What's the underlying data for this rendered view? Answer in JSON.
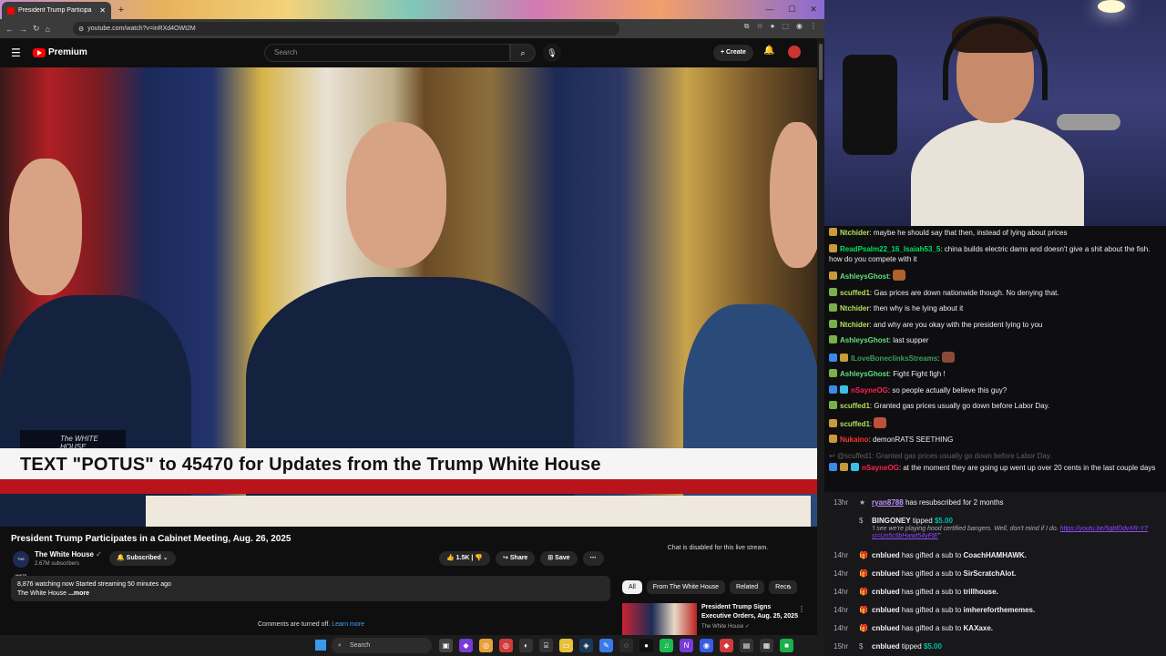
{
  "browser": {
    "tab_title": "President Trump Participa",
    "url": "youtube.com/watch?v=inRXd4OWt2M"
  },
  "youtube": {
    "brand": "Premium",
    "search_placeholder": "Search",
    "create_label": "Create",
    "video": {
      "overlay_brand": "The WHITE HOUSE",
      "lower_third": "TEXT \"POTUS\" to 45470 for Updates from the Trump White House"
    },
    "title": "President Trump Participates in a Cabinet Meeting, Aug. 26, 2025",
    "channel": {
      "name": "The White House",
      "subscribers": "2.67M subscribers",
      "avatar_text": "THE WHITE HOUSE"
    },
    "subscribed_label": "Subscribed",
    "like_count": "1.5K",
    "share_label": "Share",
    "save_label": "Save",
    "description": {
      "stats": "8,876 watching now  Started streaming 50 minutes ago",
      "channel": "The White House",
      "more": "...more"
    },
    "chat_disabled": "Chat is disabled for this live stream.",
    "chips": [
      "All",
      "From The White House",
      "Related",
      "Rece"
    ],
    "related": {
      "title": "President Trump Signs Executive Orders, Aug. 25, 2025",
      "channel": "The White House"
    },
    "comments_off": "Comments are turned off.",
    "learn_more": "Learn more"
  },
  "chat": {
    "messages": [
      {
        "user": "Ntchider",
        "text": "maybe he should say that then, instead of lying about prices",
        "color": "#b2e05a"
      },
      {
        "user": "ReadPsalm22_16_Isaiah53_5",
        "text": "china builds electric dams and doesn't give a shit about the fish. how do you compete with it",
        "color": "#00e060"
      },
      {
        "user": "AshleysGhost",
        "text": "",
        "color": "#5ee07a"
      },
      {
        "user": "scuffed1",
        "text": "Gas prices are down nationwide though. No denying that.",
        "color": "#b2e05a"
      },
      {
        "user": "Ntchider",
        "text": "then why is he lying about it",
        "color": "#b2e05a"
      },
      {
        "user": "Ntchider",
        "text": "and why are you okay with the president lying to you",
        "color": "#b2e05a"
      },
      {
        "user": "AshleysGhost",
        "text": "last supper",
        "color": "#5ee07a"
      },
      {
        "user": "ILoveBoneclinksStreams",
        "text": "",
        "color": "#3aa05a"
      },
      {
        "user": "AshleysGhost",
        "text": "Fight Fight figh !",
        "color": "#5ee07a"
      },
      {
        "user": "nSayneOG",
        "text": "so people actually believe this guy?",
        "color": "#ff2050"
      },
      {
        "user": "scuffed1",
        "text": "Granted gas prices usually go down before Labor Day.",
        "color": "#b2e05a"
      },
      {
        "user": "scuffed1",
        "text": "",
        "color": "#b2e05a"
      },
      {
        "user": "Nukaino",
        "text": "demonRATS SEETHING",
        "color": "#ff3030"
      },
      {
        "user": "@scuffed1",
        "text": "Granted gas prices usually go down before Labor Day.",
        "color": "#adadb8"
      },
      {
        "user": "nSayneOG",
        "text": "at the moment they are going up went up over 20 cents in the last couple days",
        "color": "#ff2050"
      }
    ]
  },
  "events": [
    {
      "time": "13hr",
      "user": "ryan8788",
      "text": "has resubscribed for 2 months"
    },
    {
      "time": "",
      "user": "BINGONEY",
      "text": "tipped",
      "amount": "$5.00",
      "quote": "'I see we're playing hood certified bangers. Well, don't mind if I do.",
      "link": "https://youtu.be/5gbfDdvXR-Y?si=Un5c5bHwwt54yFtE"
    },
    {
      "time": "14hr",
      "user": "cnblued",
      "text": "has gifted a sub to",
      "target": "CoachHAMHAWK."
    },
    {
      "time": "14hr",
      "user": "cnblued",
      "text": "has gifted a sub to",
      "target": "SirScratchAlot."
    },
    {
      "time": "14hr",
      "user": "cnblued",
      "text": "has gifted a sub to",
      "target": "trillhouse."
    },
    {
      "time": "14hr",
      "user": "cnblued",
      "text": "has gifted a sub to",
      "target": "imhereforthememes."
    },
    {
      "time": "14hr",
      "user": "cnblued",
      "text": "has gifted a sub to",
      "target": "KAXaxe."
    },
    {
      "time": "15hr",
      "user": "cnblued",
      "text": "tipped",
      "amount": "$5.00"
    }
  ],
  "taskbar": {
    "search_placeholder": "Search"
  }
}
